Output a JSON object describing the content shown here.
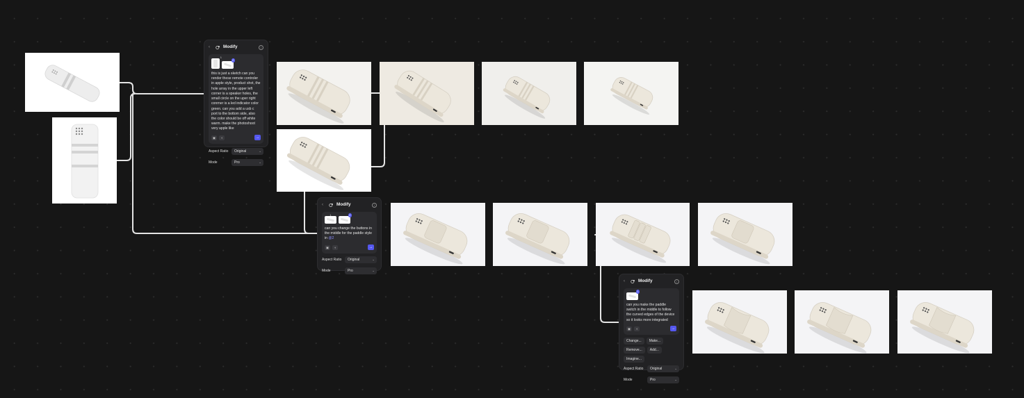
{
  "colors": {
    "background": "#161616",
    "panel": "#222224",
    "accent": "#5558ef",
    "wire": "#e4e4e4",
    "device": "#ece7dc"
  },
  "icons": {
    "back": "chevron-left-icon",
    "modify": "modify-sparkle-icon",
    "info": "info-icon",
    "send": "arrow-right-icon",
    "attach": "image-attach-icon",
    "mic": "microphone-icon",
    "select": "chevron-down-icon"
  },
  "panels": [
    {
      "title": "Modify",
      "chips": [
        "1",
        "2"
      ],
      "prompt": "this is just a sketch can you render these remote controler in apple style, product shot, the hole array in the upper left corner is a speaker holes, the small circle on the uper right conrner is a led indicator color green. can you add a usb c port to the bottom side, also the color should be off white warm. make the photoshoot very apple like",
      "aspect_label": "Aspect Ratio",
      "aspect_value": "Original",
      "mode_label": "Mode",
      "mode_value": "Pro"
    },
    {
      "title": "Modify",
      "chips": [
        "1",
        "2"
      ],
      "prompt": "can you change the buttons in the middle for the paddle style in",
      "prompt_tag": "@2",
      "aspect_label": "Aspect Ratio",
      "aspect_value": "Original",
      "mode_label": "Mode",
      "mode_value": "Pro"
    },
    {
      "title": "Modify",
      "chips": [
        "1"
      ],
      "prompt": "can you make the paddle switch in the middle to follow the curved edges of the device so it looks more integrated",
      "actions": [
        "Change...",
        "Make...",
        "Remove...",
        "Add...",
        "Imagine..."
      ],
      "aspect_label": "Aspect Ratio",
      "aspect_value": "Original",
      "mode_label": "Mode",
      "mode_value": "Pro"
    }
  ]
}
